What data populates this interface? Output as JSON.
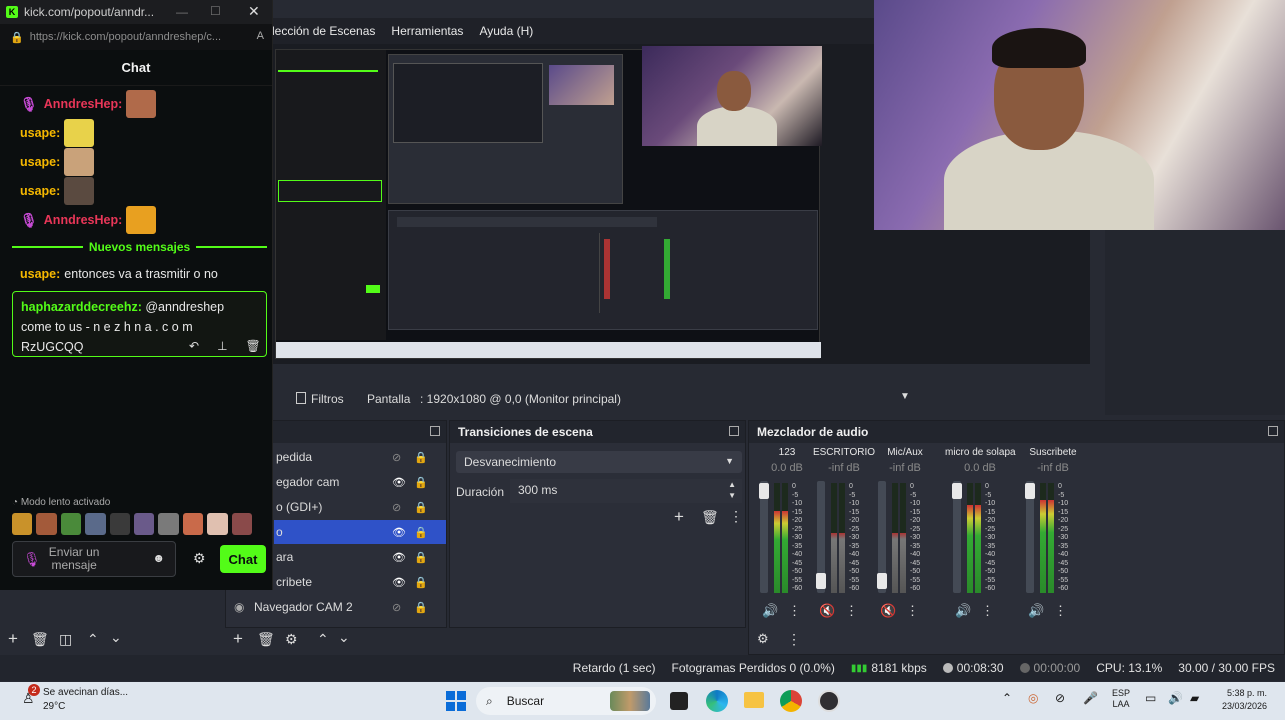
{
  "kick": {
    "window_title": "kick.com/popout/anndr...",
    "url": "https://kick.com/popout/anndreshep/c...",
    "chat_header": "Chat",
    "messages": [
      {
        "user": "AnndresHep:",
        "color": "#e93658"
      },
      {
        "user": "usape:",
        "color": "#f6b800"
      },
      {
        "user": "usape:",
        "color": "#f6b800"
      },
      {
        "user": "usape:",
        "color": "#f6b800"
      },
      {
        "user": "AnndresHep:",
        "color": "#e93658"
      }
    ],
    "new_messages_label": "Nuevos mensajes",
    "last_msg_user": "usape:",
    "last_msg_text": "entonces va a trasmitir o no",
    "highlight": {
      "user": "haphazarddecreehz:",
      "line1": "@anndreshep",
      "line2": "come to us - n e z h n a . c o m",
      "line3": "RzUGCQQ"
    },
    "slow_mode": "Modo lento activado",
    "send_placeholder_1": "Enviar un",
    "send_placeholder_2": "mensaje",
    "chat_button": "Chat"
  },
  "obs": {
    "menu": [
      "lección de Escenas",
      "Herramientas",
      "Ayuda (H)"
    ],
    "filters_label": "Filtros",
    "screen_label": "Pantalla",
    "screen_value": ": 1920x1080 @ 0,0 (Monitor principal)",
    "sources": [
      {
        "label": "pedida",
        "eye": false
      },
      {
        "label": "egador cam",
        "eye": true
      },
      {
        "label": "o (GDI+)",
        "eye": false
      },
      {
        "label": "o",
        "eye": true,
        "selected": true
      },
      {
        "label": "ara",
        "eye": true
      },
      {
        "label": "cribete",
        "eye": true
      },
      {
        "label": "Navegador CAM 2",
        "eye": false
      }
    ],
    "transitions": {
      "title": "Transiciones de escena",
      "selected": "Desvanecimiento",
      "duration_label": "Duración",
      "duration_value": "300 ms"
    },
    "mixer": {
      "title": "Mezclador de audio",
      "channels": [
        {
          "name": "123",
          "db": "0.0 dB",
          "level": 0.75,
          "muted": false
        },
        {
          "name": "ESCRITORIO",
          "db": "-inf dB",
          "level": 0.0,
          "muted": true
        },
        {
          "name": "Mic/Aux",
          "db": "-inf dB",
          "level": 0.0,
          "muted": true
        },
        {
          "name": "micro de solapa",
          "db": "0.0 dB",
          "level": 0.8,
          "muted": false
        },
        {
          "name": "Suscribete",
          "db": "-inf dB",
          "level": 0.85,
          "muted": false
        }
      ],
      "scale": [
        "0",
        "-5",
        "-10",
        "-15",
        "-20",
        "-25",
        "-30",
        "-35",
        "-40",
        "-45",
        "-50",
        "-55",
        "-60"
      ]
    },
    "status": {
      "delay": "Retardo (1 sec)",
      "dropped": "Fotogramas Perdidos 0 (0.0%)",
      "bitrate": "8181 kbps",
      "live_time": "00:08:30",
      "rec_time": "00:00:00",
      "cpu": "CPU: 13.1%",
      "fps": "30.00 / 30.00 FPS"
    }
  },
  "taskbar": {
    "weather_title": "Se avecinan días...",
    "weather_temp": "29°C",
    "badge": "2",
    "search": "Buscar",
    "lang1": "ESP",
    "lang2": "LAA",
    "time": "5:38 p. m.",
    "date": "23/03/2026"
  }
}
